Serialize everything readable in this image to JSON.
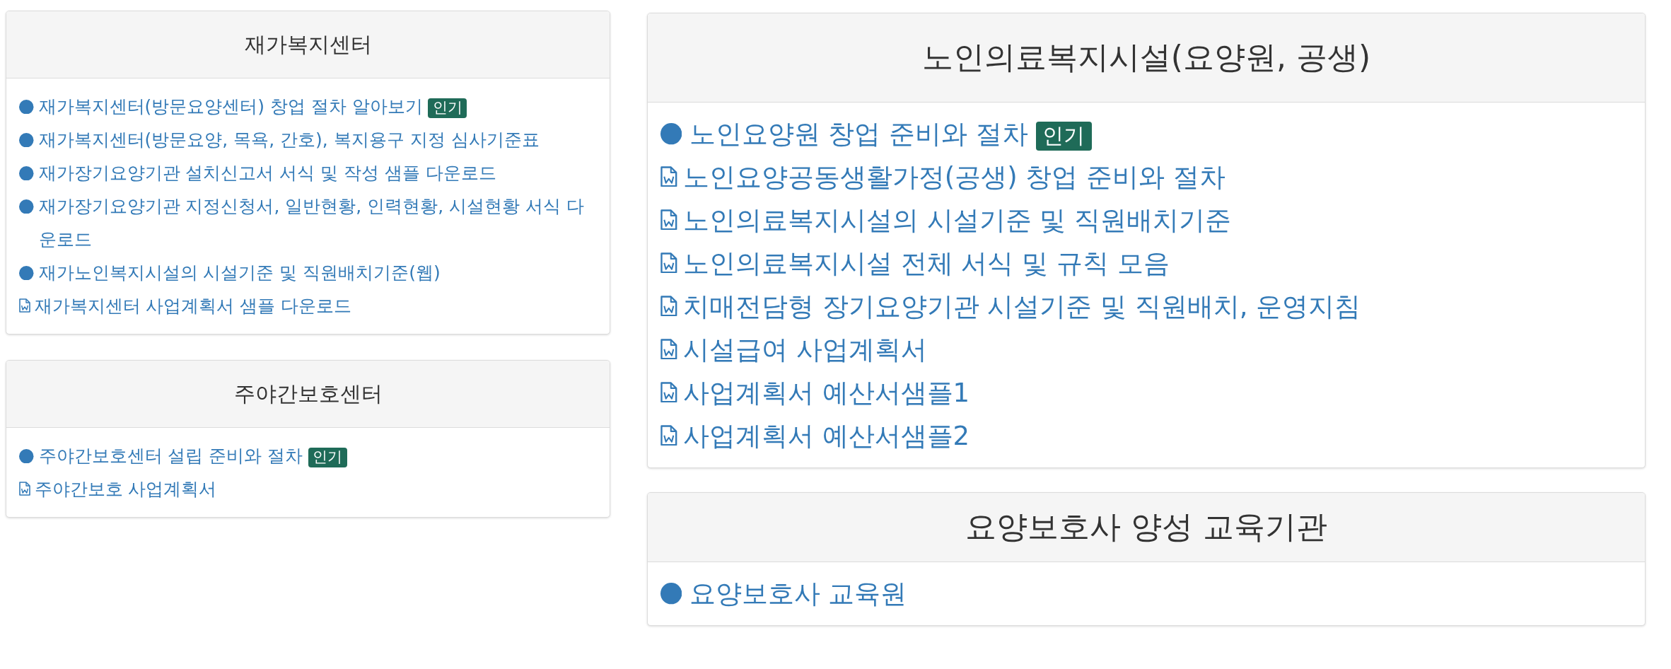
{
  "left_column": {
    "panels": [
      {
        "title": "재가복지센터",
        "items": [
          {
            "kind": "bullet",
            "label": "재가복지센터(방문요양센터) 창업 절차 알아보기",
            "badge": "인기"
          },
          {
            "kind": "bullet",
            "label": "재가복지센터(방문요양, 목욕, 간호), 복지용구 지정 심사기준표"
          },
          {
            "kind": "bullet",
            "label": "재가장기요양기관 설치신고서 서식 및 작성 샘플 다운로드"
          },
          {
            "kind": "bullet",
            "label": "재가장기요양기관 지정신청서, 일반현황, 인력현황, 시설현황 서식 다운로드"
          },
          {
            "kind": "bullet",
            "label": "재가노인복지시설의 시설기준 및 직원배치기준(웹)"
          },
          {
            "kind": "document",
            "label": "재가복지센터 사업계획서 샘플 다운로드"
          }
        ]
      },
      {
        "title": "주야간보호센터",
        "items": [
          {
            "kind": "bullet",
            "label": "주야간보호센터 설립 준비와 절차",
            "badge": "인기"
          },
          {
            "kind": "document",
            "label": "주야간보호 사업계획서"
          }
        ]
      }
    ]
  },
  "right_column": {
    "panels": [
      {
        "title": "노인의료복지시설(요양원, 공생)",
        "items": [
          {
            "kind": "bullet",
            "label": "노인요양원 창업 준비와 절차",
            "badge": "인기"
          },
          {
            "kind": "document",
            "label": "노인요양공동생활가정(공생) 창업 준비와 절차"
          },
          {
            "kind": "document",
            "label": "노인의료복지시설의 시설기준 및 직원배치기준"
          },
          {
            "kind": "document",
            "label": "노인의료복지시설 전체 서식 및 규칙 모음"
          },
          {
            "kind": "document",
            "label": "치매전담형 장기요양기관 시설기준 및 직원배치, 운영지침"
          },
          {
            "kind": "document",
            "label": "시설급여 사업계획서"
          },
          {
            "kind": "document",
            "label": "사업계획서 예산서샘플1"
          },
          {
            "kind": "document",
            "label": "사업계획서 예산서샘플2"
          }
        ]
      },
      {
        "title": "요양보호사 양성 교육기관",
        "items": [
          {
            "kind": "bullet",
            "label": "요양보호사 교육원"
          }
        ]
      }
    ]
  }
}
